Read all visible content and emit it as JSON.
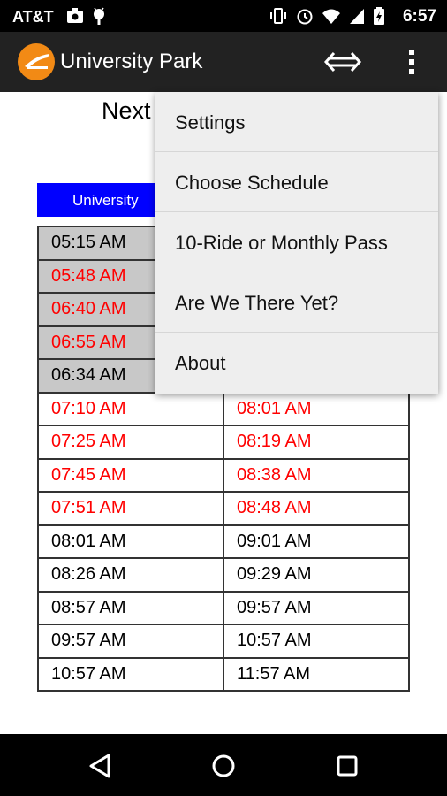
{
  "status": {
    "carrier": "AT&T",
    "time": "6:57"
  },
  "toolbar": {
    "title": "University Park"
  },
  "content": {
    "title_fragment": "Next",
    "route_header_fragment": "University"
  },
  "schedule": {
    "rows": [
      {
        "past": true,
        "c1": "05:15 AM",
        "c1_late": false,
        "c2": "",
        "c2_late": false
      },
      {
        "past": true,
        "c1": "05:48 AM",
        "c1_late": true,
        "c2": "",
        "c2_late": false
      },
      {
        "past": true,
        "c1": "06:40 AM",
        "c1_late": true,
        "c2": "",
        "c2_late": false
      },
      {
        "past": true,
        "c1": "06:55 AM",
        "c1_late": true,
        "c2": "",
        "c2_late": false
      },
      {
        "past": true,
        "c1": "06:34 AM",
        "c1_late": false,
        "c2": "",
        "c2_late": false
      },
      {
        "past": false,
        "c1": "07:10 AM",
        "c1_late": true,
        "c2": "08:01 AM",
        "c2_late": true
      },
      {
        "past": false,
        "c1": "07:25 AM",
        "c1_late": true,
        "c2": "08:19 AM",
        "c2_late": true
      },
      {
        "past": false,
        "c1": "07:45 AM",
        "c1_late": true,
        "c2": "08:38 AM",
        "c2_late": true
      },
      {
        "past": false,
        "c1": "07:51 AM",
        "c1_late": true,
        "c2": "08:48 AM",
        "c2_late": true
      },
      {
        "past": false,
        "c1": "08:01 AM",
        "c1_late": false,
        "c2": "09:01 AM",
        "c2_late": false
      },
      {
        "past": false,
        "c1": "08:26 AM",
        "c1_late": false,
        "c2": "09:29 AM",
        "c2_late": false
      },
      {
        "past": false,
        "c1": "08:57 AM",
        "c1_late": false,
        "c2": "09:57 AM",
        "c2_late": false
      },
      {
        "past": false,
        "c1": "09:57 AM",
        "c1_late": false,
        "c2": "10:57 AM",
        "c2_late": false
      },
      {
        "past": false,
        "c1": "10:57 AM",
        "c1_late": false,
        "c2": "11:57 AM",
        "c2_late": false
      }
    ]
  },
  "menu": {
    "items": [
      "Settings",
      "Choose Schedule",
      "10-Ride or Monthly Pass",
      "Are We There Yet?",
      "About"
    ]
  },
  "colors": {
    "late_text": "#ff0000",
    "route_header_bg": "#0000ff",
    "past_row_bg": "#c8c8c8",
    "logo": "#f28a15"
  },
  "icons": {
    "status_left": [
      "photo-icon",
      "android-icon"
    ],
    "status_right": [
      "vibrate-icon",
      "alarm-icon",
      "wifi-icon",
      "signal-icon",
      "battery-icon"
    ],
    "toolbar": [
      "swap-horizontal-icon",
      "more-vert-icon"
    ],
    "nav": [
      "back-icon",
      "home-icon",
      "recents-icon"
    ]
  }
}
